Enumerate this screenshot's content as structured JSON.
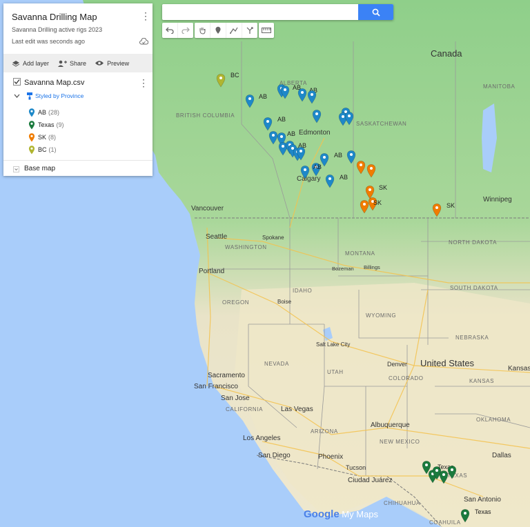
{
  "search": {
    "placeholder": "",
    "value": ""
  },
  "panel": {
    "title": "Savanna Drilling Map",
    "subtitle": "Savanna Drilling active rigs 2023",
    "last_edit": "Last edit was seconds ago",
    "actions": {
      "add_layer": "Add layer",
      "share": "Share",
      "preview": "Preview"
    },
    "layer": {
      "name": "Savanna Map.csv",
      "styled_by": "Styled by Province",
      "legend": [
        {
          "label": "AB",
          "count": "(28)",
          "color": "#1e88c8"
        },
        {
          "label": "Texas",
          "count": "(9)",
          "color": "#1b7a3d"
        },
        {
          "label": "SK",
          "count": "(8)",
          "color": "#f07c00"
        },
        {
          "label": "BC",
          "count": "(1)",
          "color": "#b0b530"
        }
      ]
    },
    "base_map": "Base map"
  },
  "map": {
    "countries": {
      "canada": "Canada",
      "us": "United States"
    },
    "provinces": [
      "BRITISH COLUMBIA",
      "ALBERTA",
      "SASKATCHEWAN",
      "MANITOBA"
    ],
    "states": [
      "WASHINGTON",
      "OREGON",
      "IDAHO",
      "MONTANA",
      "WYOMING",
      "NORTH DAKOTA",
      "SOUTH DAKOTA",
      "NEBRASKA",
      "KANSAS",
      "COLORADO",
      "UTAH",
      "NEVADA",
      "CALIFORNIA",
      "ARIZONA",
      "NEW MEXICO",
      "OKLAHOMA",
      "TEXAS",
      "CHIHUAHUA",
      "COAHUILA"
    ],
    "cities": [
      "Edmonton",
      "Calgary",
      "Vancouver",
      "Seattle",
      "Spokane",
      "Portland",
      "Boise",
      "Bozeman",
      "Billings",
      "Salt Lake City",
      "Denver",
      "Sacramento",
      "San Francisco",
      "San Jose",
      "Las Vegas",
      "Los Angeles",
      "San Diego",
      "Phoenix",
      "Tucson",
      "Albuquerque",
      "Ciudad Juárez",
      "Dallas",
      "San Antonio",
      "Winnipeg",
      "Kansas"
    ],
    "pin_labels": {
      "ab": "AB",
      "sk": "SK",
      "bc": "BC",
      "texas": "Texas"
    },
    "logo": {
      "google": "Google",
      "mymaps": "My Maps"
    }
  }
}
